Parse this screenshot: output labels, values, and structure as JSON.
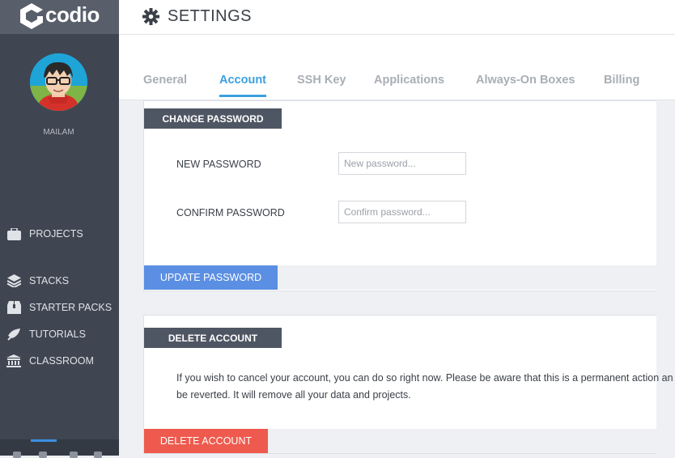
{
  "app": {
    "logo_text": "codio"
  },
  "user": {
    "name": "MAILAM"
  },
  "nav": {
    "items": [
      {
        "label": "PROJECTS",
        "icon": "briefcase-icon"
      },
      {
        "label": "STACKS",
        "icon": "stack-icon"
      },
      {
        "label": "STARTER PACKS",
        "icon": "box-icon"
      },
      {
        "label": "TUTORIALS",
        "icon": "tutorial-icon"
      },
      {
        "label": "CLASSROOM",
        "icon": "classroom-icon"
      }
    ]
  },
  "header": {
    "title": "SETTINGS",
    "icon": "gear-icon"
  },
  "tabs": [
    {
      "label": "General",
      "active": false
    },
    {
      "label": "Account",
      "active": true
    },
    {
      "label": "SSH Key",
      "active": false
    },
    {
      "label": "Applications",
      "active": false
    },
    {
      "label": "Always-On Boxes",
      "active": false
    },
    {
      "label": "Billing",
      "active": false
    }
  ],
  "change_password": {
    "heading": "CHANGE PASSWORD",
    "new_label": "NEW PASSWORD",
    "new_placeholder": "New password...",
    "confirm_label": "CONFIRM PASSWORD",
    "confirm_placeholder": "Confirm password...",
    "button": "UPDATE PASSWORD"
  },
  "delete_account": {
    "heading": "DELETE ACCOUNT",
    "text_line1": "If you wish to cancel your account, you can do so right now. Please be aware that this is a permanent action an",
    "text_line2": "be reverted. It will remove all your data and projects.",
    "button": "DELETE ACCOUNT"
  },
  "colors": {
    "sidebar": "#3f4652",
    "accent": "#3aa0e0",
    "primary_button": "#5b8fe3",
    "danger_button": "#ee5a4d",
    "section_header": "#4f5663"
  }
}
